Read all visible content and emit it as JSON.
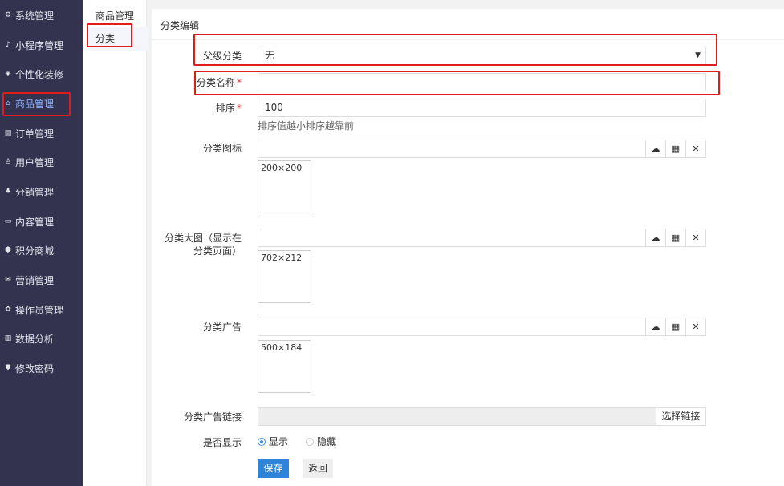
{
  "sidebar": {
    "items": [
      {
        "label": "系统管理",
        "icon": "gear-icon",
        "glyph": "⚙"
      },
      {
        "label": "小程序管理",
        "icon": "mini-program-icon",
        "glyph": "♪"
      },
      {
        "label": "个性化装修",
        "icon": "decoration-icon",
        "glyph": "◈"
      },
      {
        "label": "商品管理",
        "icon": "goods-icon",
        "glyph": "⌂"
      },
      {
        "label": "订单管理",
        "icon": "order-icon",
        "glyph": "▤"
      },
      {
        "label": "用户管理",
        "icon": "user-icon",
        "glyph": "♙"
      },
      {
        "label": "分销管理",
        "icon": "distribution-icon",
        "glyph": "♣"
      },
      {
        "label": "内容管理",
        "icon": "content-icon",
        "glyph": "▭"
      },
      {
        "label": "积分商城",
        "icon": "points-mall-icon",
        "glyph": "⬢"
      },
      {
        "label": "营销管理",
        "icon": "marketing-icon",
        "glyph": "✉"
      },
      {
        "label": "操作员管理",
        "icon": "operator-icon",
        "glyph": "✿"
      },
      {
        "label": "数据分析",
        "icon": "chart-icon",
        "glyph": "▥"
      },
      {
        "label": "修改密码",
        "icon": "shield-icon",
        "glyph": "⛊"
      }
    ],
    "active_label": "商品管理"
  },
  "subnav": {
    "title": "商品管理",
    "item": "分类"
  },
  "form": {
    "panel_title": "分类编辑",
    "parent": {
      "label": "父级分类",
      "value": "无"
    },
    "name": {
      "label": "分类名称",
      "required_mark": "*",
      "value": ""
    },
    "sort": {
      "label": "排序",
      "required_mark": "*",
      "value": "100",
      "hint": "排序值越小排序越靠前"
    },
    "icon_upload": {
      "label": "分类图标",
      "size_hint": "200×200"
    },
    "big_image": {
      "label": "分类大图（显示在分类页面）",
      "size_hint": "702×212"
    },
    "ad": {
      "label": "分类广告",
      "size_hint": "500×184"
    },
    "ad_link": {
      "label": "分类广告链接",
      "button": "选择链接"
    },
    "show": {
      "label": "是否显示",
      "options": [
        "显示",
        "隐藏"
      ],
      "selected": "显示"
    },
    "save_label": "保存",
    "back_label": "返回"
  },
  "colors": {
    "sidebar_bg": "#33334f",
    "highlight": "#e21b1b",
    "primary": "#2e84d8"
  }
}
